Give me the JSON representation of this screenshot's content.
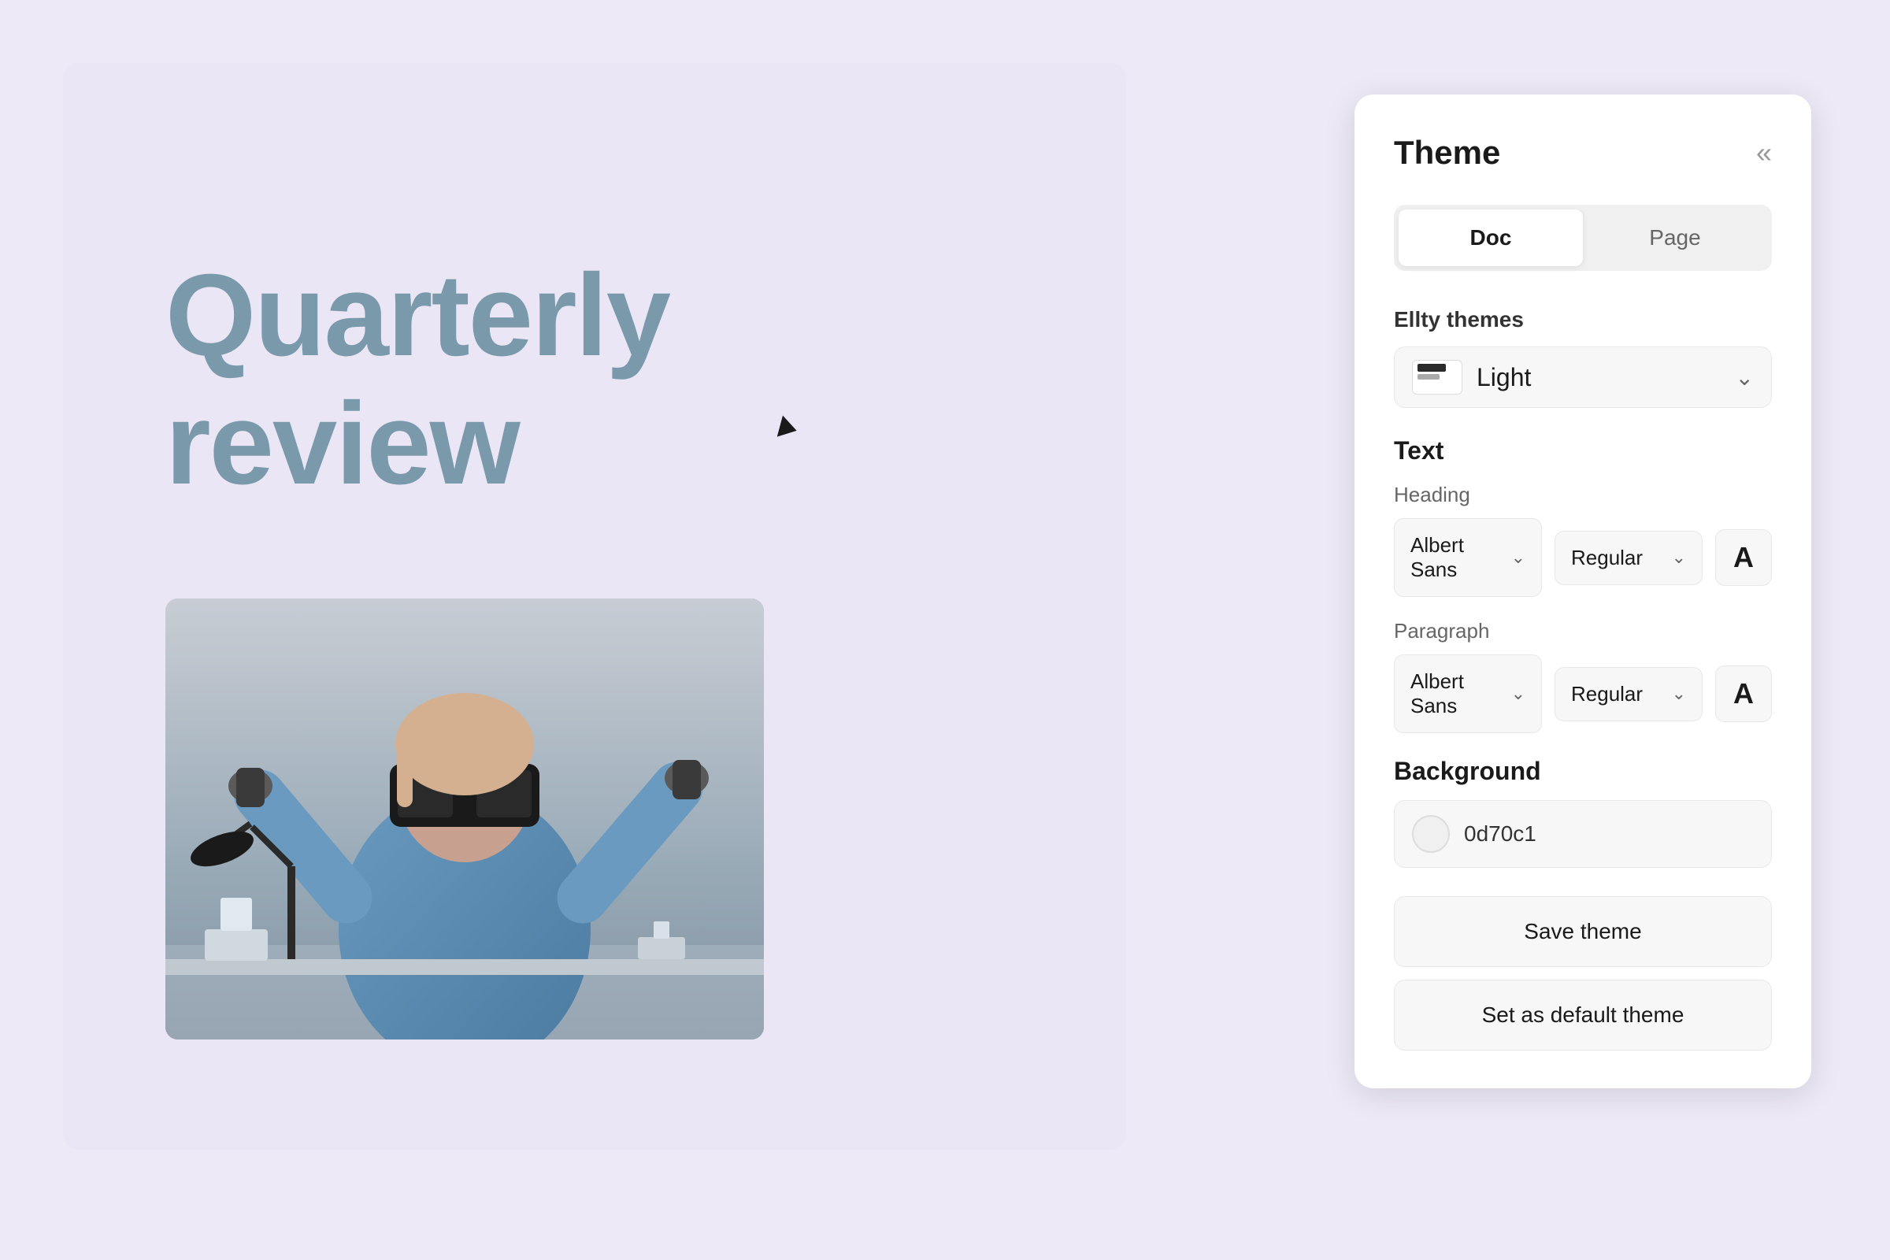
{
  "app": {
    "bg_color": "#ede9f7"
  },
  "panel": {
    "title": "Theme",
    "close_label": "«",
    "tabs": [
      {
        "id": "doc",
        "label": "Doc",
        "active": true
      },
      {
        "id": "page",
        "label": "Page",
        "active": false
      }
    ],
    "ellty_themes_label": "Ellty themes",
    "theme_selected": "Light",
    "text_section_title": "Text",
    "heading_label": "Heading",
    "heading_font": "Albert Sans",
    "heading_weight": "Regular",
    "heading_color_letter": "A",
    "paragraph_label": "Paragraph",
    "paragraph_font": "Albert Sans",
    "paragraph_weight": "Regular",
    "paragraph_color_letter": "A",
    "background_label": "Background",
    "bg_color_value": "0d70c1",
    "save_theme_label": "Save theme",
    "set_default_label": "Set as default theme"
  },
  "preview": {
    "title_line1": "Quarterly",
    "title_line2": "review"
  }
}
